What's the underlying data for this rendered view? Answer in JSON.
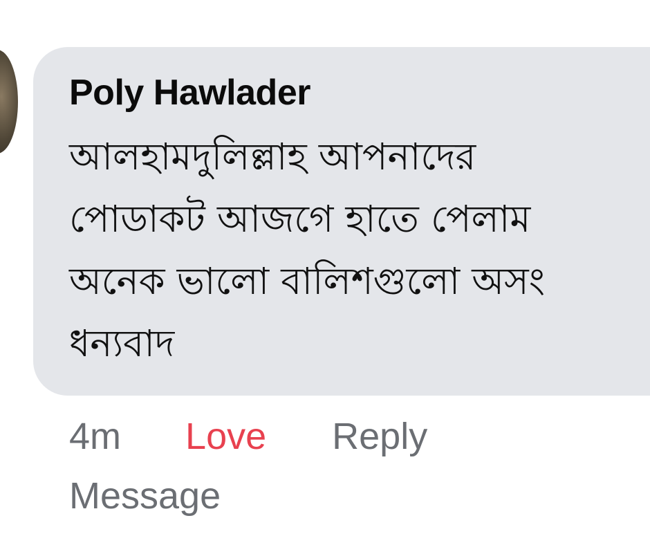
{
  "comment": {
    "author": "Poly Hawlader",
    "lines": [
      "আলহামদুলিল্লাহ আপনাদের",
      "পোডাকট আজগে হাতে পেলাম",
      "অনেক ভালো  বালিশগুলো অসং",
      "ধন্যবাদ"
    ],
    "time": "4m",
    "reaction_label": "Love",
    "reply_label": "Reply",
    "message_label": "Message",
    "colors": {
      "bubble": "#e4e6ea",
      "reaction": "#e8414f",
      "meta": "#6b6e73"
    }
  }
}
